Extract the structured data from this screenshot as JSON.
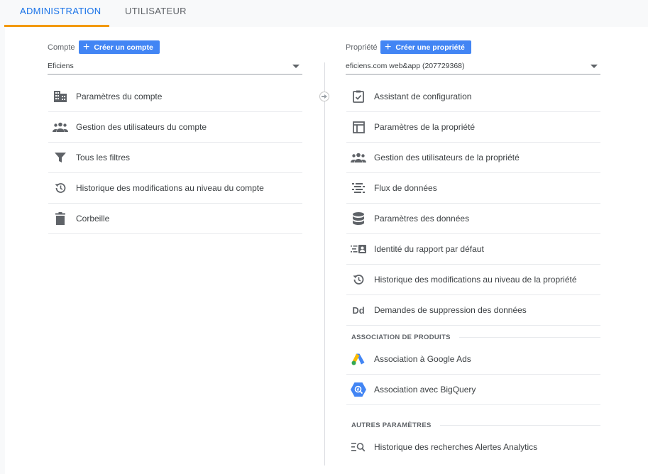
{
  "tabs": [
    {
      "label": "ADMINISTRATION",
      "active": true
    },
    {
      "label": "UTILISATEUR",
      "active": false
    }
  ],
  "account": {
    "label": "Compte",
    "create_label": "Créer un compte",
    "selected": "Eficiens",
    "items": [
      {
        "label": "Paramètres du compte",
        "icon": "building-icon"
      },
      {
        "label": "Gestion des utilisateurs du compte",
        "icon": "people-icon"
      },
      {
        "label": "Tous les filtres",
        "icon": "filter-icon"
      },
      {
        "label": "Historique des modifications au niveau du compte",
        "icon": "history-icon"
      },
      {
        "label": "Corbeille",
        "icon": "trash-icon"
      }
    ]
  },
  "property": {
    "label": "Propriété",
    "create_label": "Créer une propriété",
    "selected": "eficiens.com web&app (207729368)",
    "items": [
      {
        "label": "Assistant de configuration",
        "icon": "checklist-icon"
      },
      {
        "label": "Paramètres de la propriété",
        "icon": "layout-icon"
      },
      {
        "label": "Gestion des utilisateurs de la propriété",
        "icon": "people-icon"
      },
      {
        "label": "Flux de données",
        "icon": "data-streams-icon"
      },
      {
        "label": "Paramètres des données",
        "icon": "database-icon"
      },
      {
        "label": "Identité du rapport par défaut",
        "icon": "identity-icon"
      },
      {
        "label": "Historique des modifications au niveau de la propriété",
        "icon": "history-icon"
      },
      {
        "label": "Demandes de suppression des données",
        "icon": "dd-icon",
        "icon_text": "Dd"
      }
    ],
    "product_links": {
      "title": "ASSOCIATION DE PRODUITS",
      "items": [
        {
          "label": "Association à Google Ads",
          "icon": "google-ads-icon"
        },
        {
          "label": "Association avec BigQuery",
          "icon": "bigquery-icon"
        }
      ]
    },
    "other_settings": {
      "title": "AUTRES PARAMÈTRES",
      "items": [
        {
          "label": "Historique des recherches Alertes Analytics",
          "icon": "search-history-icon"
        }
      ]
    }
  },
  "colors": {
    "accent": "#1a73e8",
    "tab_underline": "#f29900",
    "button": "#4285f4",
    "icon": "#5f6368"
  }
}
